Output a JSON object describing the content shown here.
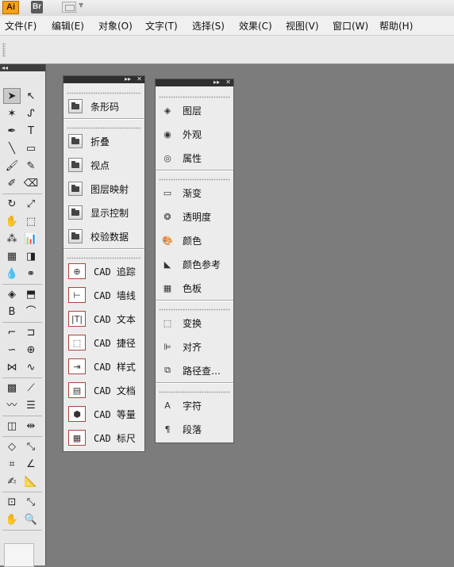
{
  "app": {
    "logo": "Ai",
    "bridge_logo": "Br"
  },
  "menubar": {
    "items": [
      {
        "label": "文件(F)"
      },
      {
        "label": "编辑(E)"
      },
      {
        "label": "对象(O)"
      },
      {
        "label": "文字(T)"
      },
      {
        "label": "选择(S)"
      },
      {
        "label": "效果(C)"
      },
      {
        "label": "视图(V)"
      },
      {
        "label": "窗口(W)"
      },
      {
        "label": "帮助(H)"
      }
    ]
  },
  "toolbox": {
    "collapse_label": "◂◂",
    "tools": [
      {
        "icon": "selection-arrow-icon",
        "glyph": "➤"
      },
      {
        "icon": "direct-selection-icon",
        "glyph": "↖"
      },
      {
        "icon": "magic-wand-icon",
        "glyph": "✶"
      },
      {
        "icon": "lasso-icon",
        "glyph": "ᔑ"
      },
      {
        "icon": "pen-icon",
        "glyph": "✒"
      },
      {
        "icon": "type-icon",
        "glyph": "T"
      },
      {
        "icon": "line-segment-icon",
        "glyph": "╲"
      },
      {
        "icon": "rectangle-icon",
        "glyph": "▭"
      },
      {
        "icon": "paintbrush-icon",
        "glyph": "🖌"
      },
      {
        "icon": "pencil-icon",
        "glyph": "✎"
      },
      {
        "icon": "blob-brush-icon",
        "glyph": "✐"
      },
      {
        "icon": "eraser-icon",
        "glyph": "⌫"
      },
      {
        "icon": "rotate-icon",
        "glyph": "↻"
      },
      {
        "icon": "scale-icon",
        "glyph": "⤢"
      },
      {
        "icon": "warp-icon",
        "glyph": "✋"
      },
      {
        "icon": "free-transform-icon",
        "glyph": "⬚"
      },
      {
        "icon": "symbol-sprayer-icon",
        "glyph": "⁂"
      },
      {
        "icon": "column-graph-icon",
        "glyph": "📊"
      },
      {
        "icon": "mesh-icon",
        "glyph": "▦"
      },
      {
        "icon": "gradient-icon",
        "glyph": "◨"
      },
      {
        "icon": "eyedropper-icon",
        "glyph": "💧"
      },
      {
        "icon": "blend-icon",
        "glyph": "⚭"
      },
      {
        "icon": "live-paint-bucket-icon",
        "glyph": "◈"
      },
      {
        "icon": "live-paint-selection-icon",
        "glyph": "⬒"
      },
      {
        "icon": "base-tool-icon",
        "glyph": "B"
      },
      {
        "icon": "cad-arc-icon",
        "glyph": "⌒"
      },
      {
        "icon": "cad-fillet-icon",
        "glyph": "⌐"
      },
      {
        "icon": "cad-offset-icon",
        "glyph": "⊐"
      },
      {
        "icon": "cad-curve-icon",
        "glyph": "∽"
      },
      {
        "icon": "target-icon",
        "glyph": "⊕"
      },
      {
        "icon": "envelope-icon",
        "glyph": "⋈"
      },
      {
        "icon": "wave-icon",
        "glyph": "∿"
      },
      {
        "icon": "grid-tool-icon",
        "glyph": "▩"
      },
      {
        "icon": "knife-icon",
        "glyph": "⟋"
      },
      {
        "icon": "zigzag-icon",
        "glyph": "〰"
      },
      {
        "icon": "list-icon",
        "glyph": "☰"
      },
      {
        "icon": "cad-rect-icon",
        "glyph": "◫"
      },
      {
        "icon": "cad-dim-icon",
        "glyph": "⇹"
      },
      {
        "icon": "cad-poly-icon",
        "glyph": "◇"
      },
      {
        "icon": "cad-measure-icon",
        "glyph": "⤡"
      },
      {
        "icon": "cad-crop-icon",
        "glyph": "⌗"
      },
      {
        "icon": "cad-angle-icon",
        "glyph": "∠"
      },
      {
        "icon": "graph-pen-icon",
        "glyph": "✍"
      },
      {
        "icon": "ruler-pen-icon",
        "glyph": "📐"
      },
      {
        "icon": "artboard-icon",
        "glyph": "⊡"
      },
      {
        "icon": "slice-icon",
        "glyph": "⤡"
      },
      {
        "icon": "hand-icon",
        "glyph": "✋"
      },
      {
        "icon": "zoom-icon",
        "glyph": "🔍"
      }
    ]
  },
  "panel_left": {
    "header_controls": [
      "▸▸",
      "✕"
    ],
    "groups": [
      [
        {
          "label": "条形码",
          "icon": "folder-icon"
        }
      ],
      [
        {
          "label": "折叠",
          "icon": "folder-icon"
        },
        {
          "label": "视点",
          "icon": "folder-icon"
        },
        {
          "label": "图层映射",
          "icon": "folder-icon"
        },
        {
          "label": "显示控制",
          "icon": "folder-icon"
        },
        {
          "label": "校验数据",
          "icon": "folder-icon"
        }
      ],
      [
        {
          "label": "CAD 追踪",
          "icon": "cad-track-icon",
          "glyph": "⊕"
        },
        {
          "label": "CAD 墙线",
          "icon": "cad-wall-icon",
          "glyph": "⊢"
        },
        {
          "label": "CAD 文本",
          "icon": "cad-text-icon",
          "glyph": "|T|"
        },
        {
          "label": "CAD 捷径",
          "icon": "cad-shortcut-icon",
          "glyph": "⬚"
        },
        {
          "label": "CAD 样式",
          "icon": "cad-style-icon",
          "glyph": "⇥"
        },
        {
          "label": "CAD 文档",
          "icon": "cad-document-icon",
          "glyph": "▤"
        },
        {
          "label": "CAD 等量",
          "icon": "cad-isometric-icon",
          "glyph": "⬢"
        },
        {
          "label": "CAD 标尺",
          "icon": "cad-ruler-icon",
          "glyph": "▦"
        }
      ]
    ]
  },
  "panel_right": {
    "header_controls": [
      "▸▸",
      "✕"
    ],
    "groups": [
      [
        {
          "label": "图层",
          "icon": "layers-icon",
          "glyph": "◈"
        },
        {
          "label": "外观",
          "icon": "appearance-icon",
          "glyph": "◉"
        },
        {
          "label": "属性",
          "icon": "attributes-icon",
          "glyph": "◎"
        }
      ],
      [
        {
          "label": "渐变",
          "icon": "gradient-icon",
          "glyph": "▭"
        },
        {
          "label": "透明度",
          "icon": "transparency-icon",
          "glyph": "❂"
        },
        {
          "label": "颜色",
          "icon": "color-icon",
          "glyph": "🎨"
        },
        {
          "label": "颜色参考",
          "icon": "color-guide-icon",
          "glyph": "◣"
        },
        {
          "label": "色板",
          "icon": "swatches-icon",
          "glyph": "▦"
        }
      ],
      [
        {
          "label": "变换",
          "icon": "transform-icon",
          "glyph": "⬚"
        },
        {
          "label": "对齐",
          "icon": "align-icon",
          "glyph": "⊫"
        },
        {
          "label": "路径查…",
          "icon": "pathfinder-icon",
          "glyph": "⧉"
        }
      ],
      [
        {
          "label": "字符",
          "icon": "character-icon",
          "glyph": "A"
        },
        {
          "label": "段落",
          "icon": "paragraph-icon",
          "glyph": "¶"
        }
      ]
    ]
  }
}
